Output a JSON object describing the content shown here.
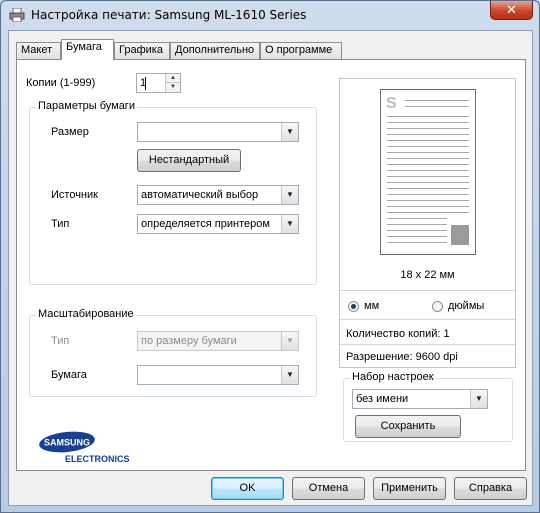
{
  "window": {
    "title": "Настройка печати: Samsung ML-1610 Series",
    "close_glyph": "✕"
  },
  "tabs": [
    {
      "label": "Макет"
    },
    {
      "label": "Бумага"
    },
    {
      "label": "Графика"
    },
    {
      "label": "Дополнительно"
    },
    {
      "label": "О программе"
    }
  ],
  "copies": {
    "label": "Копии (1-999)",
    "value": "1"
  },
  "paper_options": {
    "title": "Параметры бумаги",
    "size_label": "Размер",
    "size_value": "",
    "custom_button": "Нестандартный",
    "source_label": "Источник",
    "source_value": "автоматический выбор",
    "type_label": "Тип",
    "type_value": "определяется принтером"
  },
  "scaling": {
    "title": "Масштабирование",
    "type_label": "Тип",
    "type_value": "по размеру бумаги",
    "paper_label": "Бумага",
    "paper_value": ""
  },
  "preview": {
    "page_letter": "S",
    "dimensions": "18 x 22 мм",
    "unit_mm": "мм",
    "unit_inches": "дюймы",
    "copies_info": "Количество копий: 1",
    "resolution_info": "Разрешение: 9600 dpi"
  },
  "favorites": {
    "title": "Набор настроек",
    "value": "без имени",
    "save_button": "Сохранить"
  },
  "logo": {
    "line1": "SAMSUNG",
    "line2": "ELECTRONICS"
  },
  "buttons": {
    "ok": "OK",
    "cancel": "Отмена",
    "apply": "Применить",
    "help": "Справка"
  },
  "colors": {
    "accent": "#1d3b5c",
    "logo_blue": "#1a3f8f"
  }
}
